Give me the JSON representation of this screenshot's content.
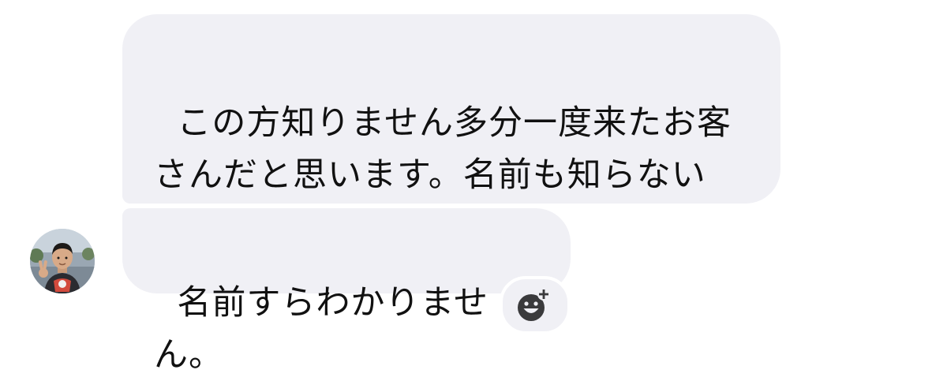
{
  "messages": [
    {
      "text": "この方知りません多分一度来たお客\nさんだと思います。名前も知らない\nです。"
    },
    {
      "text": "名前すらわかりません。"
    }
  ],
  "sender": {
    "avatar_icon": "profile-photo"
  },
  "reaction_button": {
    "icon": "add-reaction-icon",
    "color": "#3a3a3c"
  },
  "theme": {
    "bubble_bg": "#f0f0f5",
    "text_color": "#111111",
    "page_bg": "#ffffff"
  }
}
